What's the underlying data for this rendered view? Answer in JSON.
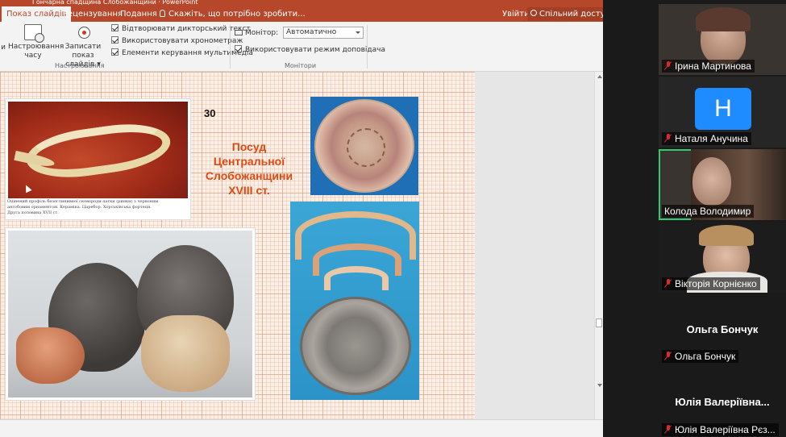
{
  "window": {
    "title": "Гончарна спадщина Слобожанщини · PowerPoint"
  },
  "ribbon": {
    "tabs": [
      {
        "label": "Показ слайдів",
        "active": true
      },
      {
        "label": "Рецензування",
        "active": false
      },
      {
        "label": "Подання",
        "active": false
      }
    ],
    "tell_me": "Скажіть, що потрібно зробити...",
    "sign_in": "Увійти",
    "share": "Спільний доступ",
    "buttons": {
      "partial_label": "и",
      "rehearse_timings": "Настроювання часу",
      "record_show": "Записати показ слайдів"
    },
    "record_dropdown_arrow": "▾",
    "checkboxes": {
      "play_narrations": "Відтворювати дикторський текст",
      "use_timings": "Використовувати хронометраж",
      "show_media_controls": "Елементи керування мультимедіа",
      "use_presenter_view": "Використовувати режим доповідача"
    },
    "monitor_label": "Монітор:",
    "monitor_value": "Автоматично",
    "group_setup": "Настроювання",
    "group_monitors": "Монітори"
  },
  "slide": {
    "number": "30",
    "title_lines": [
      "Посуд",
      "Центральної",
      "Слобожанщини",
      "XVIII ст."
    ],
    "caption_lines": [
      "Оцінений профіль безоглинивної сковороди-латки (ринки) з червоним",
      "ангобовим орнаментом. Кераміка. Царебор. Хорськівська фортеця.",
      "Друга половина XVII ст."
    ]
  },
  "participants": [
    {
      "name": "Ірина Мартинова",
      "muted": true,
      "video": true
    },
    {
      "name": "Наталя Анучина",
      "muted": true,
      "video": false,
      "initial": "Н"
    },
    {
      "name": "Колода Володимир",
      "muted": false,
      "video": true,
      "active": true
    },
    {
      "name": "Вікторія Корнієнко",
      "muted": true,
      "video": true
    },
    {
      "name": "Ольга Бончук",
      "display_name": "Ольга Бончук",
      "muted": true,
      "video": false
    },
    {
      "name": "Юлія Валеріївна Рєз...",
      "display_name": "Юлія Валеріївна...",
      "muted": true,
      "video": false
    }
  ],
  "colors": {
    "ppt_accent": "#b7472a",
    "title_color": "#e04a12",
    "active_speaker": "#2ecc71",
    "muted_icon": "#e02828",
    "avatar_bg": "#1e8cff"
  },
  "icons": [
    "lightbulb-icon",
    "person-icon",
    "timing-icon",
    "record-icon",
    "monitor-icon",
    "mic-muted-icon",
    "checkbox-checked-icon"
  ]
}
